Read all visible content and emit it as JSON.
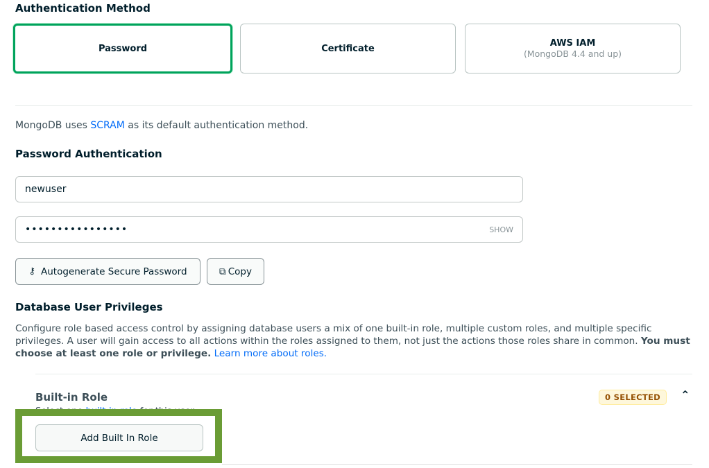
{
  "auth": {
    "title": "Authentication Method",
    "methods": [
      {
        "label": "Password",
        "selected": true
      },
      {
        "label": "Certificate",
        "selected": false
      },
      {
        "label": "AWS IAM",
        "sub": "(MongoDB 4.4 and up)",
        "selected": false
      }
    ],
    "scram_pre": "MongoDB uses ",
    "scram_link": "SCRAM",
    "scram_post": " as its default authentication method."
  },
  "password_auth": {
    "title": "Password Authentication",
    "username": "newuser",
    "password": "••••••••••••••••",
    "show_label": "SHOW",
    "autogen_label": "Autogenerate Secure Password",
    "copy_label": "Copy"
  },
  "privileges": {
    "title": "Database User Privileges",
    "desc": "Configure role based access control by assigning database users a mix of one built-in role, multiple custom roles, and multiple specific privileges. A user will gain access to all actions within the roles assigned to them, not just the actions those roles share in common. ",
    "desc_bold": "You must choose at least one role or privilege.",
    "learn_more": "Learn more about roles."
  },
  "builtin": {
    "title": "Built-in Role",
    "badge": "0 SELECTED",
    "hint_pre": "Select one ",
    "hint_link": "built-in role",
    "hint_post": " for this user.",
    "add_label": "Add Built In Role"
  },
  "colors": {
    "selected_border": "#00a35c",
    "highlight": "#6a9c35",
    "link": "#016bf8"
  }
}
